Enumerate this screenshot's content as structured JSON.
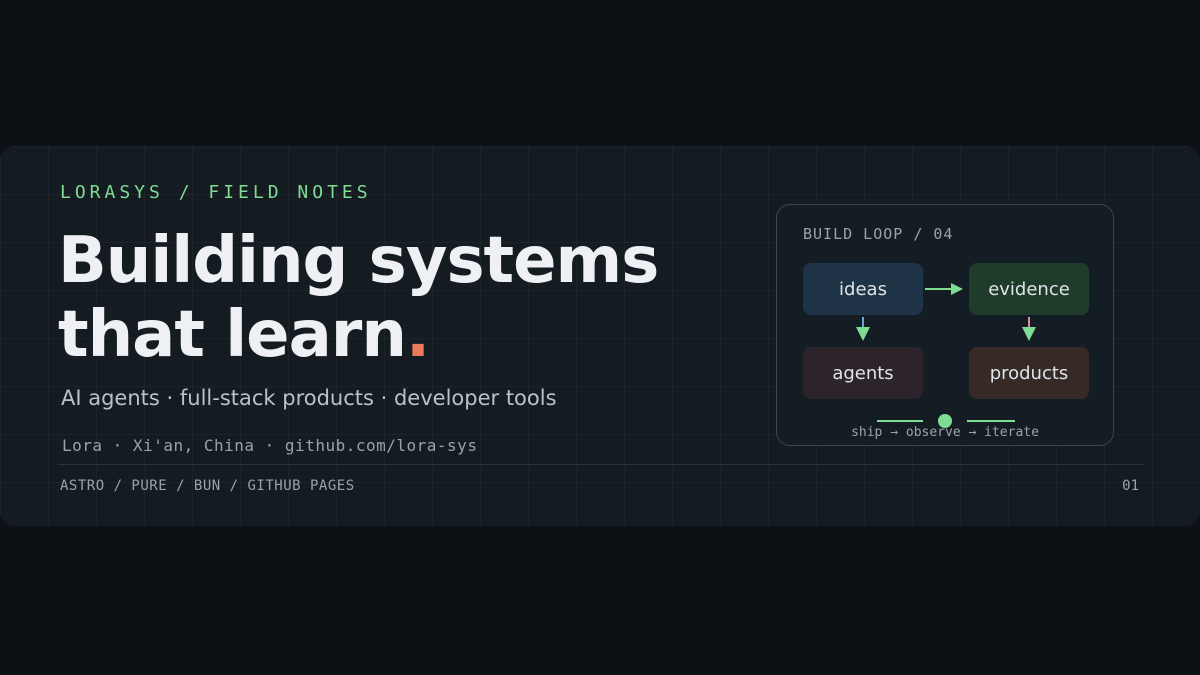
{
  "banner": {
    "eyebrow": "LORASYS / FIELD NOTES",
    "title_line1": "Building systems",
    "title_line2": "that learn",
    "title_dot": ".",
    "subtitle": "AI agents · full-stack products · developer tools",
    "byline": "Lora · Xi'an, China · github.com/lora-sys",
    "stack": "ASTRO / PURE / BUN / GITHUB PAGES",
    "page_number": "01"
  },
  "loop_card": {
    "title": "BUILD LOOP / 04",
    "nodes": {
      "ideas": "ideas",
      "evidence": "evidence",
      "agents": "agents",
      "products": "products"
    },
    "caption": "ship → observe → iterate"
  },
  "colors": {
    "accent_green": "#7fdc93",
    "accent_coral": "#e97a5b",
    "background": "#0d1014",
    "panel": "#141b21"
  }
}
